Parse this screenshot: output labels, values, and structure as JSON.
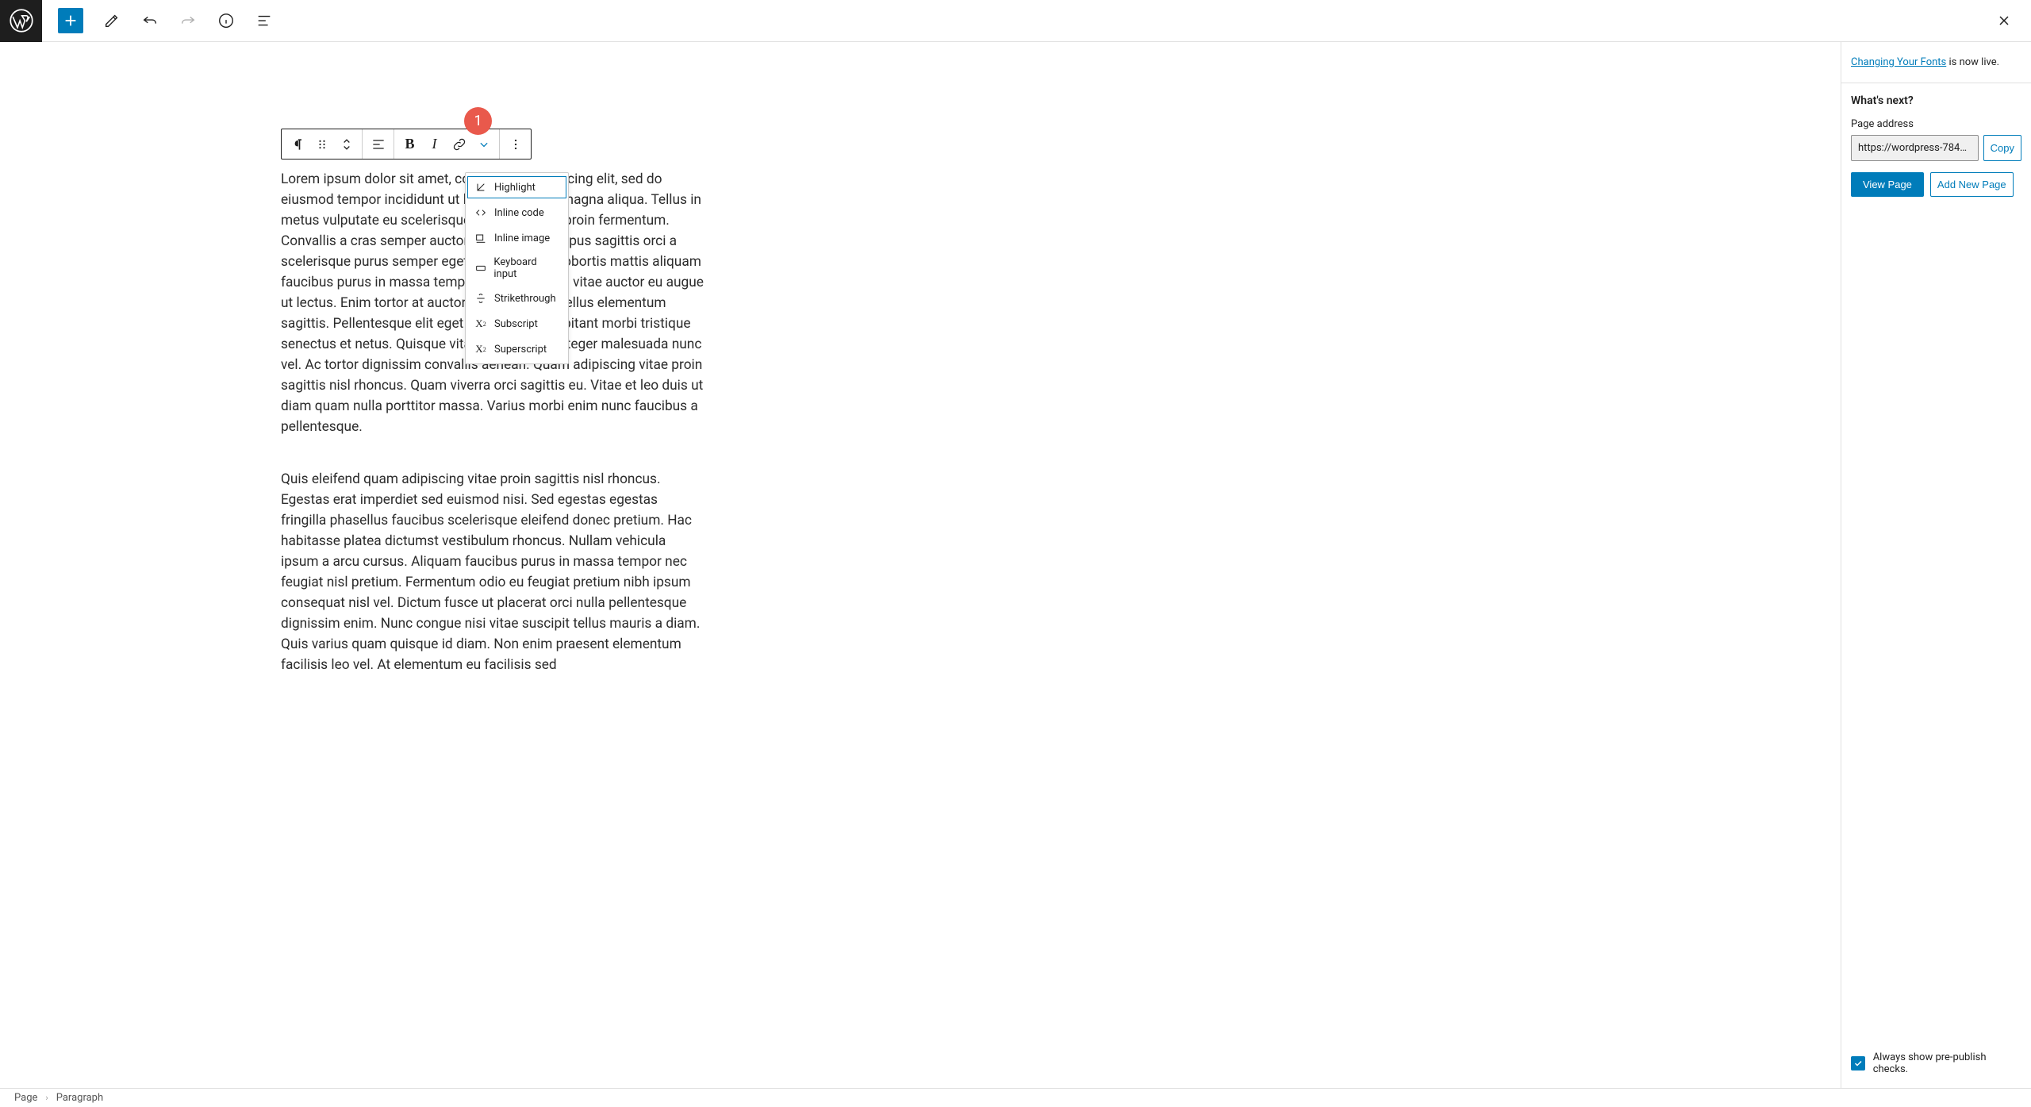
{
  "sidebar": {
    "notice_prefix": "",
    "notice_link": "Changing Your Fonts",
    "notice_suffix": " is now live.",
    "whats_next": "What's next?",
    "page_address_label": "Page address",
    "page_address_value": "https://wordpress-7848...",
    "copy_label": "Copy",
    "view_page_label": "View Page",
    "add_new_label": "Add New Page",
    "always_show_prepub": "Always show pre-publish checks."
  },
  "toolbar": {
    "bold": "B",
    "italic": "I"
  },
  "dropdown": {
    "items": [
      {
        "label": "Highlight"
      },
      {
        "label": "Inline code"
      },
      {
        "label": "Inline image"
      },
      {
        "label": "Keyboard input"
      },
      {
        "label": "Strikethrough"
      },
      {
        "label": "Subscript"
      },
      {
        "label": "Superscript"
      }
    ]
  },
  "badge": {
    "text": "1"
  },
  "paragraphs": {
    "p1": "Lorem ipsum dolor sit amet, consectetur adipiscing elit, sed do eiusmod tempor incididunt ut labore et dolore magna aliqua. Tellus in metus vulputate eu scelerisque felis imperdiet proin fermentum. Convallis a cras semper auctor neque vitae tempus sagittis orci a scelerisque purus semper eget duis at tellus. Lobortis mattis aliquam faucibus purus in massa tempor nec eu ultrices vitae auctor eu augue ut lectus. Enim tortor at auctor mattis enim ut tellus elementum sagittis. Pellentesque elit eget pellentesque habitant morbi tristique senectus et netus. Quisque vitae ultricies leo integer malesuada nunc vel. Ac tortor dignissim convallis aenean. Quam adipiscing vitae proin sagittis nisl rhoncus. Quam viverra orci sagittis eu. Vitae et leo duis ut diam quam nulla porttitor massa. Varius morbi enim nunc faucibus a pellentesque.",
    "p2": "Quis eleifend quam adipiscing vitae proin sagittis nisl rhoncus. Egestas erat imperdiet sed euismod nisi. Sed egestas egestas fringilla phasellus faucibus scelerisque eleifend donec pretium. Hac habitasse platea dictumst vestibulum rhoncus. Nullam vehicula ipsum a arcu cursus. Aliquam faucibus purus in massa tempor nec feugiat nisl pretium. Fermentum odio eu feugiat pretium nibh ipsum consequat nisl vel. Dictum fusce ut placerat orci nulla pellentesque dignissim enim. Nunc congue nisi vitae suscipit tellus mauris a diam. Quis varius quam quisque id diam. Non enim praesent elementum facilisis leo vel. At elementum eu facilisis sed"
  },
  "footer": {
    "page": "Page",
    "block": "Paragraph"
  }
}
